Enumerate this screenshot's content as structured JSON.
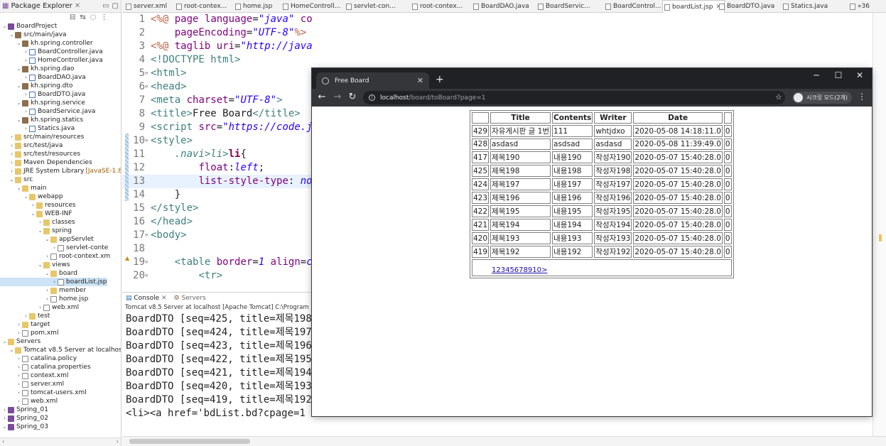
{
  "package_explorer": {
    "title": "Package Explorer",
    "items": [
      {
        "label": "BoardProject",
        "depth": 0,
        "icon": "project",
        "expanded": true
      },
      {
        "label": "src/main/java",
        "depth": 1,
        "icon": "package",
        "expanded": true
      },
      {
        "label": "kh.spring.controller",
        "depth": 2,
        "icon": "package",
        "expanded": true
      },
      {
        "label": "BoardController.java",
        "depth": 3,
        "icon": "java",
        "expanded": false
      },
      {
        "label": "HomeController.java",
        "depth": 3,
        "icon": "java",
        "expanded": false
      },
      {
        "label": "kh.spring.dao",
        "depth": 2,
        "icon": "package",
        "expanded": true
      },
      {
        "label": "BoardDAO.java",
        "depth": 3,
        "icon": "java",
        "expanded": false
      },
      {
        "label": "kh.spring.dto",
        "depth": 2,
        "icon": "package",
        "expanded": true
      },
      {
        "label": "BoardDTO.java",
        "depth": 3,
        "icon": "java",
        "expanded": false
      },
      {
        "label": "kh.spring.service",
        "depth": 2,
        "icon": "package",
        "expanded": true
      },
      {
        "label": "BoardService.java",
        "depth": 3,
        "icon": "java",
        "expanded": false
      },
      {
        "label": "kh.spring.statics",
        "depth": 2,
        "icon": "package",
        "expanded": true
      },
      {
        "label": "Statics.java",
        "depth": 3,
        "icon": "java",
        "expanded": false
      },
      {
        "label": "src/main/resources",
        "depth": 1,
        "icon": "folder",
        "expanded": false
      },
      {
        "label": "src/test/java",
        "depth": 1,
        "icon": "folder",
        "expanded": false
      },
      {
        "label": "src/test/resources",
        "depth": 1,
        "icon": "folder",
        "expanded": false
      },
      {
        "label": "Maven Dependencies",
        "depth": 1,
        "icon": "folder",
        "expanded": false
      },
      {
        "label": "JRE System Library",
        "decoration": "[JavaSE-1.8",
        "depth": 1,
        "icon": "folder",
        "expanded": false
      },
      {
        "label": "src",
        "depth": 1,
        "icon": "folder",
        "expanded": true
      },
      {
        "label": "main",
        "depth": 2,
        "icon": "folder",
        "expanded": true
      },
      {
        "label": "webapp",
        "depth": 3,
        "icon": "folder",
        "expanded": true
      },
      {
        "label": "resources",
        "depth": 4,
        "icon": "folder",
        "expanded": false
      },
      {
        "label": "WEB-INF",
        "depth": 4,
        "icon": "folder",
        "expanded": true
      },
      {
        "label": "classes",
        "depth": 5,
        "icon": "folder",
        "expanded": false
      },
      {
        "label": "spring",
        "depth": 5,
        "icon": "folder",
        "expanded": true
      },
      {
        "label": "appServlet",
        "depth": 6,
        "icon": "folder",
        "expanded": true
      },
      {
        "label": "servlet-conte",
        "depth": 7,
        "icon": "file",
        "expanded": false
      },
      {
        "label": "root-context.xm",
        "depth": 6,
        "icon": "file",
        "expanded": false
      },
      {
        "label": "views",
        "depth": 5,
        "icon": "folder",
        "expanded": true
      },
      {
        "label": "board",
        "depth": 6,
        "icon": "folder",
        "expanded": true
      },
      {
        "label": "boardList.jsp",
        "depth": 7,
        "icon": "file",
        "expanded": false,
        "selected": true
      },
      {
        "label": "member",
        "depth": 6,
        "icon": "folder",
        "expanded": false
      },
      {
        "label": "home.jsp",
        "depth": 6,
        "icon": "file",
        "expanded": false
      },
      {
        "label": "web.xml",
        "depth": 5,
        "icon": "file",
        "expanded": false
      },
      {
        "label": "test",
        "depth": 3,
        "icon": "folder",
        "expanded": false
      },
      {
        "label": "target",
        "depth": 2,
        "icon": "folder",
        "expanded": false
      },
      {
        "label": "pom.xml",
        "depth": 2,
        "icon": "file",
        "expanded": false
      },
      {
        "label": "Servers",
        "depth": 0,
        "icon": "folder",
        "expanded": true
      },
      {
        "label": "Tomcat v8.5 Server at localhos",
        "depth": 1,
        "icon": "folder",
        "expanded": true
      },
      {
        "label": "catalina.policy",
        "depth": 2,
        "icon": "file",
        "expanded": false
      },
      {
        "label": "catalina.properties",
        "depth": 2,
        "icon": "file",
        "expanded": false
      },
      {
        "label": "context.xml",
        "depth": 2,
        "icon": "file",
        "expanded": false
      },
      {
        "label": "server.xml",
        "depth": 2,
        "icon": "file",
        "expanded": false
      },
      {
        "label": "tomcat-users.xml",
        "depth": 2,
        "icon": "file",
        "expanded": false
      },
      {
        "label": "web.xml",
        "depth": 2,
        "icon": "file",
        "expanded": false
      },
      {
        "label": "Spring_01",
        "depth": 0,
        "icon": "project",
        "expanded": false
      },
      {
        "label": "Spring_02",
        "depth": 0,
        "icon": "project",
        "expanded": false
      },
      {
        "label": "Spring_03",
        "depth": 0,
        "icon": "project",
        "expanded": true
      }
    ]
  },
  "editor_tabs": [
    {
      "label": "server.xml",
      "active": false
    },
    {
      "label": "root-contex...",
      "active": false
    },
    {
      "label": "home.jsp",
      "active": false
    },
    {
      "label": "HomeControll...",
      "active": false
    },
    {
      "label": "servlet-con...",
      "active": false
    },
    {
      "label": "root-contex...",
      "active": false
    },
    {
      "label": "BoardDAO.java",
      "active": false
    },
    {
      "label": "BoardServic...",
      "active": false
    },
    {
      "label": "BoardControl...",
      "active": false
    },
    {
      "label": "boardList.jsp",
      "active": true
    },
    {
      "label": "BoardDTO.java",
      "active": false
    },
    {
      "label": "Statics.java",
      "active": false
    },
    {
      "label": "»36",
      "active": false
    }
  ],
  "code_lines": [
    {
      "n": "1",
      "fold": "",
      "html": "<span class=\"jsp\">&lt;%@</span> <span class=\"a\">page</span> <span class=\"a\">language</span>=<span class=\"s\">\"java\"</span> <span class=\"a\">contentType</span>=<span class=\"s\">\"text/html; charset=UTF-8\"</span>"
    },
    {
      "n": "2",
      "fold": "",
      "html": "    <span class=\"a\">pageEncoding</span>=<span class=\"s\">\"UTF-8\"</span><span class=\"jsp\">%&gt;</span>"
    },
    {
      "n": "3",
      "fold": "",
      "html": "<span class=\"jsp\">&lt;%@</span> <span class=\"a\">taglib</span> <span class=\"a\">uri</span>=<span class=\"s\">\"http://java.sun.com/jsp/jstl/core\"</span> <span class=\"a\">prefix</span>=<span class=\"s\">\"c\"</span> <span class=\"jsp\">%&gt;</span>"
    },
    {
      "n": "4",
      "fold": "",
      "html": "<span class=\"t\">&lt;!DOCTYPE html&gt;</span>"
    },
    {
      "n": "5",
      "fold": "⊖",
      "html": "<span class=\"t\">&lt;html&gt;</span>"
    },
    {
      "n": "6",
      "fold": "⊖",
      "html": "<span class=\"t\">&lt;head&gt;</span>"
    },
    {
      "n": "7",
      "fold": "",
      "html": "<span class=\"t\">&lt;meta</span> <span class=\"a\">charset</span>=<span class=\"s\">\"UTF-8\"</span><span class=\"t\">&gt;</span>"
    },
    {
      "n": "8",
      "fold": "",
      "html": "<span class=\"t\">&lt;title&gt;</span>Free Board<span class=\"t\">&lt;/title&gt;</span>"
    },
    {
      "n": "9",
      "fold": "",
      "html": "<span class=\"t\">&lt;script</span> <span class=\"a\">src</span>=<span class=\"s\">\"https://code.jquery.com/jquery-3.5.0.min.js\"</span><span class=\"t\">&gt;</span>"
    },
    {
      "n": "10",
      "fold": "⊖",
      "html": "<span class=\"t\">&lt;style&gt;</span>"
    },
    {
      "n": "11",
      "fold": "",
      "html": "    <span class=\"sel-css\">.navi&gt;li&gt;</span><span class=\"k\"><b>li</b></span>{"
    },
    {
      "n": "12",
      "fold": "",
      "html": "        <span class=\"prop\">float</span>:<span class=\"s\">left</span>;"
    },
    {
      "n": "13",
      "fold": "",
      "html": "        <span class=\"prop\">list-style-type</span>: <span class=\"s\">none</span>;",
      "hl": true
    },
    {
      "n": "14",
      "fold": "",
      "html": "    }"
    },
    {
      "n": "15",
      "fold": "",
      "html": "<span class=\"t\">&lt;/style&gt;</span>"
    },
    {
      "n": "16",
      "fold": "",
      "html": "<span class=\"t\">&lt;/head&gt;</span>"
    },
    {
      "n": "17",
      "fold": "⊖",
      "html": "<span class=\"t\">&lt;body&gt;</span>"
    },
    {
      "n": "18",
      "fold": "",
      "html": ""
    },
    {
      "n": "19",
      "fold": "⊖",
      "html": "    <span class=\"t\">&lt;table</span> <span class=\"a\">border</span>=<span class=\"s\">1</span> <span class=\"a\">align</span>=<span class=\"s\">center</span><span class=\"t\">&gt;</span>"
    },
    {
      "n": "20",
      "fold": "⊖",
      "html": "        <span class=\"t\">&lt;tr&gt;</span>"
    }
  ],
  "console": {
    "tab_console": "Console",
    "tab_servers": "Servers",
    "description": "Tomcat v8.5 Server at localhost [Apache Tomcat] C:\\Program Files\\Java",
    "lines": [
      "BoardDTO [seq=425, title=제목198",
      "BoardDTO [seq=424, title=제목197",
      "BoardDTO [seq=423, title=제목196",
      "BoardDTO [seq=422, title=제목195",
      "BoardDTO [seq=421, title=제목194",
      "BoardDTO [seq=420, title=제목193",
      "BoardDTO [seq=419, title=제목192",
      "<li><a href='bdList.bd?cpage=1"
    ]
  },
  "browser": {
    "tab_title": "Free Board",
    "url_host": "localhost",
    "url_path": "/board/toBoard?page=1",
    "incognito_label": "시크릿 모드(2개)",
    "columns": [
      "",
      "Title",
      "Contents",
      "Writer",
      "Date",
      ""
    ],
    "rows": [
      [
        "429",
        "자유게시판 글 1번",
        "111",
        "whtjdxo",
        "2020-05-08 14:18:11.0",
        "0"
      ],
      [
        "428",
        "asdasd",
        "asdsad",
        "asdasd",
        "2020-05-08 11:39:49.0",
        "0"
      ],
      [
        "417",
        "제목190",
        "내용190",
        "작성자190",
        "2020-05-07 15:40:28.0",
        "0"
      ],
      [
        "425",
        "제목198",
        "내용198",
        "작성자198",
        "2020-05-07 15:40:28.0",
        "0"
      ],
      [
        "424",
        "제목197",
        "내용197",
        "작성자197",
        "2020-05-07 15:40:28.0",
        "0"
      ],
      [
        "423",
        "제목196",
        "내용196",
        "작성자196",
        "2020-05-07 15:40:28.0",
        "0"
      ],
      [
        "422",
        "제목195",
        "내용195",
        "작성자195",
        "2020-05-07 15:40:28.0",
        "0"
      ],
      [
        "421",
        "제목194",
        "내용194",
        "작성자194",
        "2020-05-07 15:40:28.0",
        "0"
      ],
      [
        "420",
        "제목193",
        "내용193",
        "작성자193",
        "2020-05-07 15:40:28.0",
        "0"
      ],
      [
        "419",
        "제목192",
        "내용192",
        "작성자192",
        "2020-05-07 15:40:28.0",
        "0"
      ]
    ],
    "pager": "12345678910>"
  },
  "icons": {
    "minimize": "─",
    "maximize": "☐",
    "close": "✕",
    "back": "←",
    "forward": "→",
    "reload": "↻",
    "star": "☆",
    "menu": "⋮",
    "new_tab": "+"
  }
}
